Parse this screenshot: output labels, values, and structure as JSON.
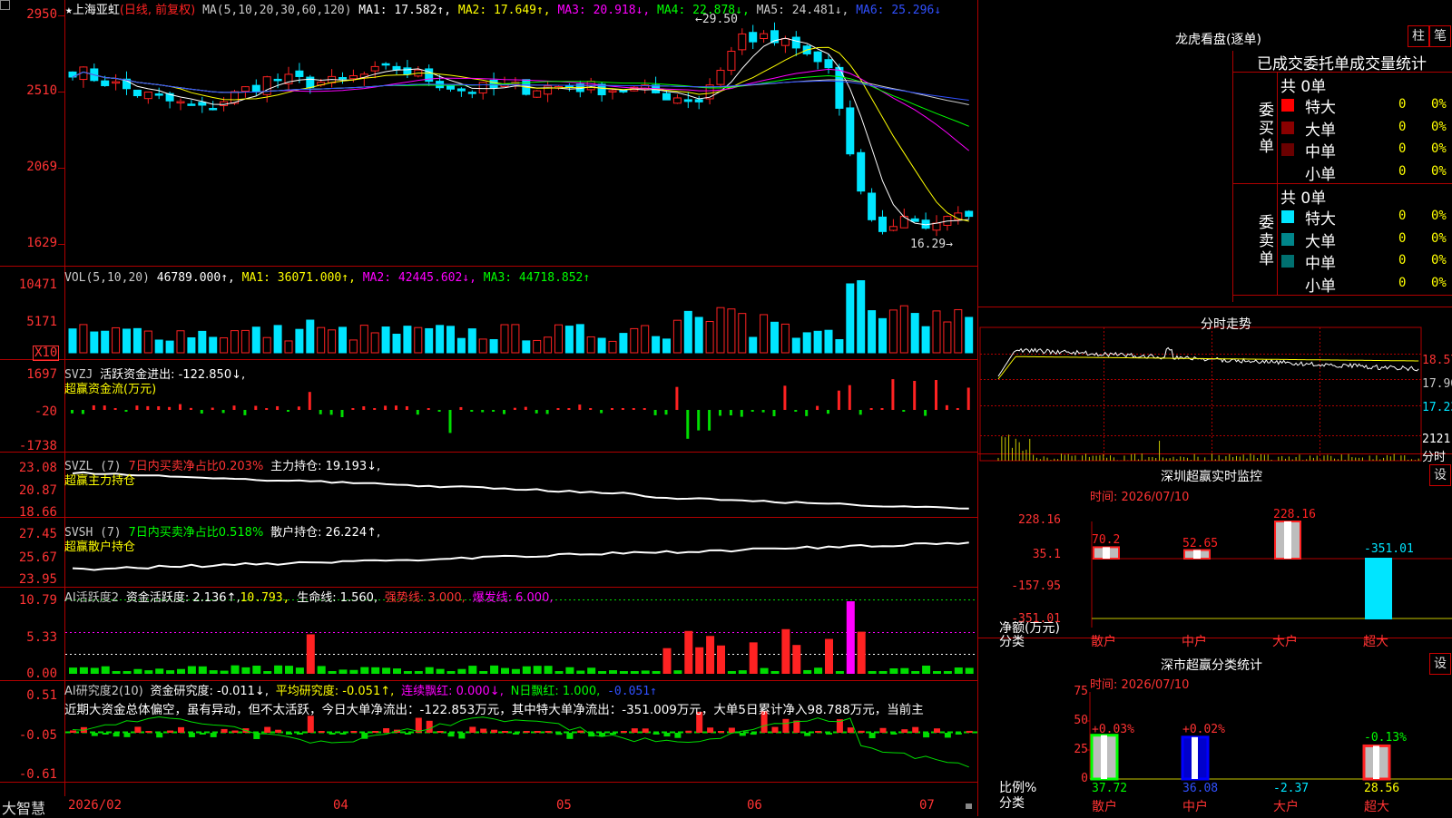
{
  "colors": {
    "up": "#ff2222",
    "down": "#00e5ff",
    "grid": "#b00000",
    "ma1": "#ffffff",
    "ma2": "#ffff00",
    "ma3": "#ff00ff",
    "ma4": "#00ff00",
    "ma5": "#c8c8c8",
    "ma6": "#3050ff",
    "green": "#00dd00",
    "yellow": "#ffff00",
    "magenta": "#ff00ff"
  },
  "header": {
    "star": "★",
    "name": "上海亚虹",
    "period": "(日线, 前复权)",
    "ma_spec": "MA(5,10,20,30,60,120)",
    "ma1": "MA1: 17.582↑,",
    "ma2": "MA2: 17.649↑,",
    "ma3": "MA3: 20.918↓,",
    "ma4": "MA4: 22.878↓,",
    "ma5": "MA5: 24.481↓,",
    "ma6": "MA6: 25.296↓"
  },
  "price_axis": [
    "2950",
    "2510",
    "2069",
    "1629"
  ],
  "price_hi": "29.50",
  "price_lo": "16.29",
  "vol": {
    "title": "VOL(5,10,20)",
    "v": "46789.000↑,",
    "ma1": "MA1: 36071.000↑,",
    "ma2": "MA2: 42445.602↓,",
    "ma3": "MA3: 44718.852↑",
    "axis": [
      "10471",
      "5171"
    ],
    "unit": "X10"
  },
  "svzj": {
    "title": "SVZJ",
    "line": "活跃资金进出: -122.850↓,",
    "sub": "超赢资金流(万元)",
    "axis": [
      "1697",
      "-20",
      "-1738"
    ]
  },
  "svzl": {
    "title": "SVZL (7)",
    "pct": "7日内买卖净占比0.203%",
    "hold": "主力持仓: 19.193↓,",
    "sub": "超赢主力持仓",
    "axis": [
      "23.08",
      "20.87",
      "18.66"
    ]
  },
  "svsh": {
    "title": "SVSH (7)",
    "pct": "7日内买卖净占比0.518%",
    "hold": "散户持仓: 26.224↑,",
    "sub": "超赢散户持仓",
    "axis": [
      "27.45",
      "25.67",
      "23.95"
    ]
  },
  "ai1": {
    "title": "AI活跃度2",
    "a": "资金活跃度: 2.136↑,",
    "b": "10.793,",
    "c": "生命线: 1.560,",
    "d": "强势线: 3.000,",
    "e": "爆发线: 6.000,",
    "axis": [
      "10.79",
      "5.33",
      "0.00"
    ]
  },
  "ai2": {
    "title": "AI研究度2(10)",
    "a": "资金研究度: -0.011↓,",
    "b": "平均研究度: -0.051↑,",
    "c": "连续飘红: 0.000↓,",
    "d": "N日飘红: 1.000,",
    "e": "-0.051↑",
    "note": "近期大资金总体偏空，虽有异动，但不太活跃，今日大单净流出：-122.853万元，其中特大单净流出：-351.009万元，大单5日累计净入98.788万元，当前主",
    "axis": [
      "0.51",
      "-0.05",
      "-0.61"
    ]
  },
  "xaxis": {
    "brand": "大智慧",
    "labels": [
      "2026/02",
      "04",
      "05",
      "06",
      "07"
    ]
  },
  "right": {
    "lhkp": "龙虎看盘(逐单)",
    "btn_zhu": "柱",
    "btn_bi": "笔",
    "lhkp_sub": "已成交委托单成交量统计",
    "buy_label": "委买单",
    "sell_label": "委卖单",
    "buy_total": "共 0单",
    "sell_total": "共 0单",
    "rows": [
      "特大",
      "大单",
      "中单",
      "小单"
    ],
    "zero": "0",
    "pct": "0%",
    "fenshi": "分时走势",
    "fs_axis": [
      "18.57",
      "17.90",
      "17.23",
      "2121"
    ],
    "fs_unit": "分时",
    "sz_title": "深圳超赢实时监控",
    "settings": "设",
    "time1": "时间: 2026/07/10",
    "sz_axis": [
      "228.16",
      "35.1",
      "-157.95",
      "-351.01"
    ],
    "sz_vals": [
      "70.2",
      "52.65",
      "228.16",
      "-351.01"
    ],
    "sz_ylabel": "净额(万元)",
    "cat_label": "分类",
    "cats": [
      "散户",
      "中户",
      "大户",
      "超大"
    ],
    "sh_title": "深市超赢分类统计",
    "time2": "时间: 2026/07/10",
    "sh_axis": [
      "75",
      "50",
      "25",
      "0"
    ],
    "sh_top": [
      "+0.03%",
      "+0.02%",
      "-0.13%"
    ],
    "sh_bottom": [
      "37.72",
      "36.08",
      "-2.37",
      "28.56"
    ],
    "sh_ylabel": "比例%"
  },
  "chart_data": [
    {
      "type": "bar",
      "title": "深圳超赢实时监控",
      "categories": [
        "散户",
        "中户",
        "大户",
        "超大"
      ],
      "values": [
        70.2,
        52.65,
        228.16,
        -351.01
      ],
      "ylabel": "净额(万元)",
      "ylim": [
        -351.01,
        228.16
      ]
    },
    {
      "type": "bar",
      "title": "深市超赢分类统计",
      "categories": [
        "散户",
        "中户",
        "大户",
        "超大"
      ],
      "values": [
        37.72,
        36.08,
        -2.37,
        28.56
      ],
      "ylabel": "比例%",
      "ylim": [
        0,
        75
      ]
    },
    {
      "type": "line",
      "title": "MA(5,10,20,30,60,120)",
      "series": [
        {
          "name": "MA1",
          "values": [
            17.582
          ]
        },
        {
          "name": "MA2",
          "values": [
            17.649
          ]
        },
        {
          "name": "MA3",
          "values": [
            20.918
          ]
        },
        {
          "name": "MA4",
          "values": [
            22.878
          ]
        },
        {
          "name": "MA5",
          "values": [
            24.481
          ]
        },
        {
          "name": "MA6",
          "values": [
            25.296
          ]
        }
      ]
    }
  ]
}
